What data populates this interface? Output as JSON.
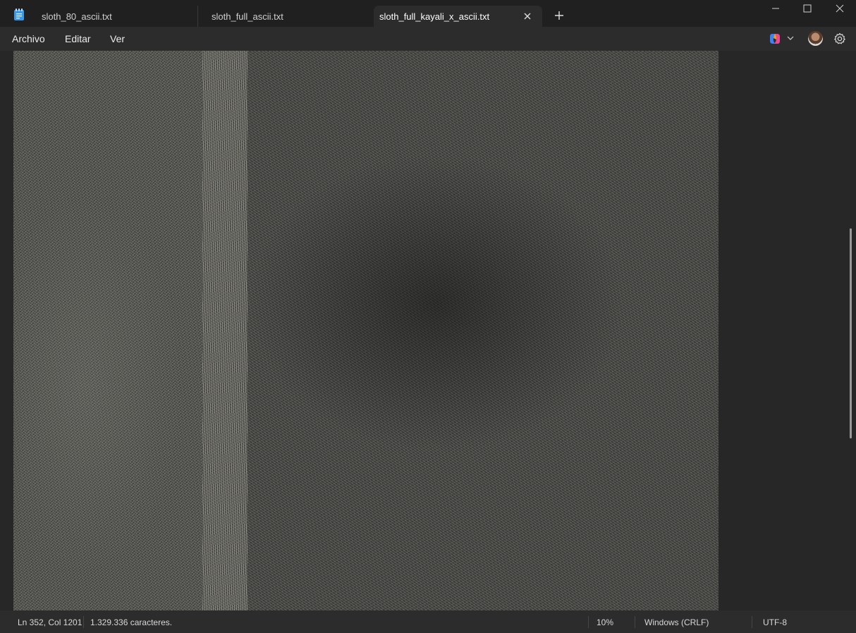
{
  "app": {
    "icon": "notepad-icon"
  },
  "tabs": [
    {
      "label": "sloth_80_ascii.txt",
      "active": false
    },
    {
      "label": "sloth_full_ascii.txt",
      "active": false
    },
    {
      "label": "sloth_full_kayali_x_ascii.txt",
      "active": true
    }
  ],
  "menu": {
    "archivo": "Archivo",
    "editar": "Editar",
    "ver": "Ver"
  },
  "status": {
    "position": "Ln 352, Col 1201",
    "characters": "1.329.336 caracteres.",
    "zoom": "10%",
    "line_endings": "Windows (CRLF)",
    "encoding": "UTF-8"
  },
  "colors": {
    "accent": "#4aa3ff",
    "background": "#272727",
    "ascii_text": "#c8c8b8"
  }
}
